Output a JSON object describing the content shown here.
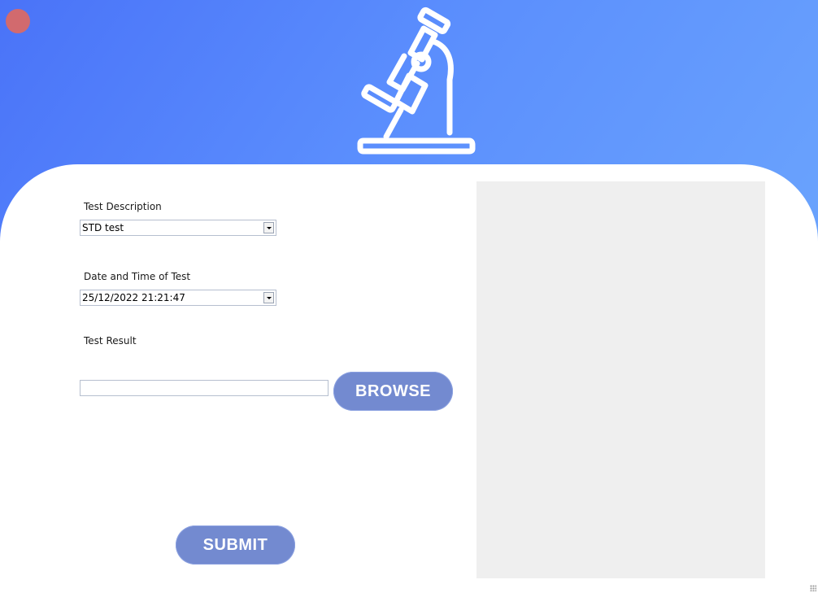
{
  "header": {
    "logo_icon": "microscope-icon",
    "close_icon": "close-circle-icon",
    "gradient_colors": [
      "#4a73f8",
      "#6aa3fd"
    ]
  },
  "form": {
    "test_description": {
      "label": "Test Description",
      "value": "STD test"
    },
    "date_time": {
      "label": "Date and Time of Test",
      "value": "25/12/2022 21:21:47"
    },
    "test_result": {
      "label": "Test Result",
      "value": "",
      "browse_label": "BROWSE"
    },
    "submit_label": "SUBMIT"
  },
  "colors": {
    "button": "#738ad0",
    "close": "#d26a6e",
    "preview_bg": "#efefef"
  }
}
